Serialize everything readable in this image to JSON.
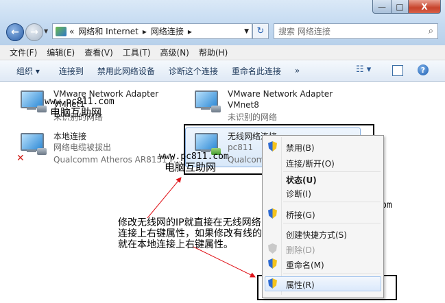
{
  "window": {
    "min_label": "—",
    "max_label": "□",
    "close_label": "X"
  },
  "address": {
    "overflow": "«",
    "crumb1": "网络和 Internet",
    "crumb2": "网络连接",
    "sep": "▸"
  },
  "search": {
    "placeholder": "搜索 网络连接"
  },
  "menu": [
    "文件(F)",
    "编辑(E)",
    "查看(V)",
    "工具(T)",
    "高级(N)",
    "帮助(H)"
  ],
  "toolbar": {
    "organize": "组织 ▾",
    "connect_to": "连接到",
    "disable_device": "禁用此网络设备",
    "diagnose": "诊断这个连接",
    "rename": "重命名此连接",
    "more": "»",
    "view_icon": "view-options-icon",
    "help_label": "?"
  },
  "connections": [
    {
      "name": "VMware Network Adapter",
      "name2": "VMnet1",
      "status": "未识别的网络"
    },
    {
      "name": "VMware Network Adapter",
      "name2": "VMnet8",
      "status": "未识别的网络"
    },
    {
      "name": "本地连接",
      "status": "网络电缆被拔出",
      "device": "Qualcomm Atheros AR8151 P..."
    },
    {
      "name": "无线网络连接",
      "status": "pc811",
      "device": "Qualcomm"
    }
  ],
  "watermarks": {
    "url": "www.pc811.com",
    "site": "电脑互助网"
  },
  "context_menu": {
    "disable": "禁用(B)",
    "connect": "连接/断开(O)",
    "status": "状态(U)",
    "diagnose": "诊断(I)",
    "bridge": "桥接(G)",
    "shortcut": "创建快捷方式(S)",
    "delete": "删除(D)",
    "rename": "重命名(M)",
    "properties": "属性(R)"
  },
  "annotation": "修改无线网的IP就直接在无线网络连接上右键属性，如果修改有线的就在本地连接上右键属性。"
}
